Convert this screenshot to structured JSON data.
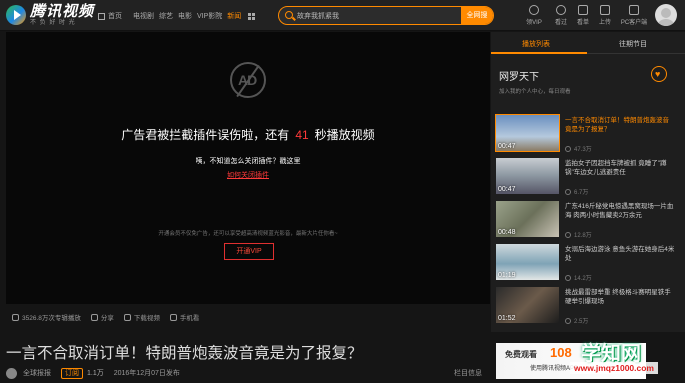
{
  "brand": {
    "name": "腾讯视频",
    "slogan": "不 负 好 时 光"
  },
  "nav": {
    "home": "首页",
    "items": [
      "电视剧",
      "综艺",
      "电影",
      "VIP影院",
      "新闻"
    ],
    "active": "新闻"
  },
  "search": {
    "placeholder": "故弃我抓紧我",
    "button": "全网搜"
  },
  "toolbar": [
    "领VIP",
    "看过",
    "看单",
    "上传",
    "PC客户端"
  ],
  "player": {
    "ad_message_prefix": "广告君被拦截插件误伤啦，还有",
    "countdown": "41",
    "ad_message_suffix": "秒播放视频",
    "question": "咦，不知道怎么关闭插件？戳这里",
    "link": "如何关闭插件",
    "vip_note": "开通会员不仅免广告，还可以享受超高清视频蓝光影音，最新大片任你看~",
    "vip_button": "开通VIP",
    "logo_glyph": "AD"
  },
  "controls": [
    {
      "icon": "play-count-icon",
      "label": "3526.8万次专辑播放"
    },
    {
      "icon": "share-icon",
      "label": "分享"
    },
    {
      "icon": "download-icon",
      "label": "下载视频"
    },
    {
      "icon": "phone-icon",
      "label": "手机看"
    }
  ],
  "video": {
    "title": "一言不合取消订单！特朗普炮轰波音竟是为了报复？",
    "channel": "全球报报",
    "subscribe": "订阅",
    "subscribers": "1.1万",
    "date": "2016年12月07日发布",
    "column": "栏目信息"
  },
  "sidebar": {
    "tabs": [
      "播放列表",
      "往期节目"
    ],
    "active_tab": "播放列表",
    "playlist_title": "网罗天下",
    "playlist_desc": "加入我的个人中心，每日观看",
    "items": [
      {
        "title": "一言不合取消订单！特朗普炮轰波音竟是为了报复？",
        "duration": "00:47",
        "count": "47.3万",
        "active": true
      },
      {
        "title": "监拍女子因超挡车牌被抓 竟睡了\"蹲锅\"车边女儿逃避责任",
        "duration": "00:47",
        "count": "6.7万",
        "active": false
      },
      {
        "title": "广东416斤秘党电惊遇黑窝现场一片血海 肉两小时售藏卖2万余元",
        "duration": "00:48",
        "count": "12.8万",
        "active": false
      },
      {
        "title": "女溺后海边游泳 意鱼头游在她身后4米处",
        "duration": "01:19",
        "count": "14.2万",
        "active": false
      },
      {
        "title": "挑战最雷部举重 终极格斗赛明星铁手硬举引爆现场",
        "duration": "01:52",
        "count": "2.5万",
        "active": false
      }
    ]
  },
  "banner": {
    "prefix": "免费观看",
    "number": "108",
    "sub": "使用腾讯视频APP"
  },
  "watermark": {
    "line1": "学知网",
    "line2": "www.jmqz1000.com"
  }
}
